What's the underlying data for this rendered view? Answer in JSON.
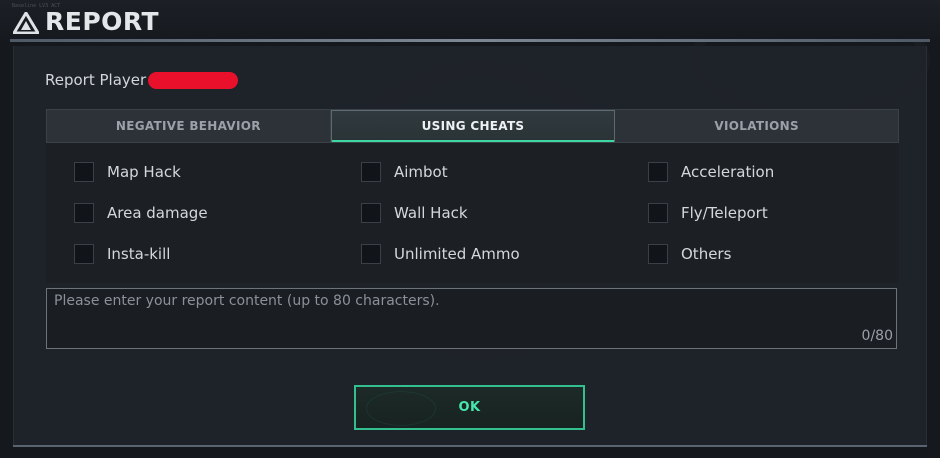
{
  "header": {
    "title": "REPORT",
    "caption": "Baseline  LV3 ACT"
  },
  "report": {
    "player_label": "Report Player"
  },
  "tabs": [
    {
      "label": "NEGATIVE BEHAVIOR",
      "active": false
    },
    {
      "label": "USING CHEATS",
      "active": true
    },
    {
      "label": "VIOLATIONS",
      "active": false
    }
  ],
  "options": [
    {
      "label": "Map Hack",
      "checked": false
    },
    {
      "label": "Aimbot",
      "checked": false
    },
    {
      "label": "Acceleration",
      "checked": false
    },
    {
      "label": "Area damage",
      "checked": false
    },
    {
      "label": "Wall Hack",
      "checked": false
    },
    {
      "label": "Fly/Teleport",
      "checked": false
    },
    {
      "label": "Insta-kill",
      "checked": false
    },
    {
      "label": "Unlimited Ammo",
      "checked": false
    },
    {
      "label": "Others",
      "checked": false
    }
  ],
  "content_field": {
    "placeholder": "Please enter your report content (up to 80 characters).",
    "value": "",
    "counter": "0/80"
  },
  "ok_button": {
    "label": "OK"
  },
  "colors": {
    "accent": "#3ed7a2",
    "redaction": "#e8102a"
  }
}
